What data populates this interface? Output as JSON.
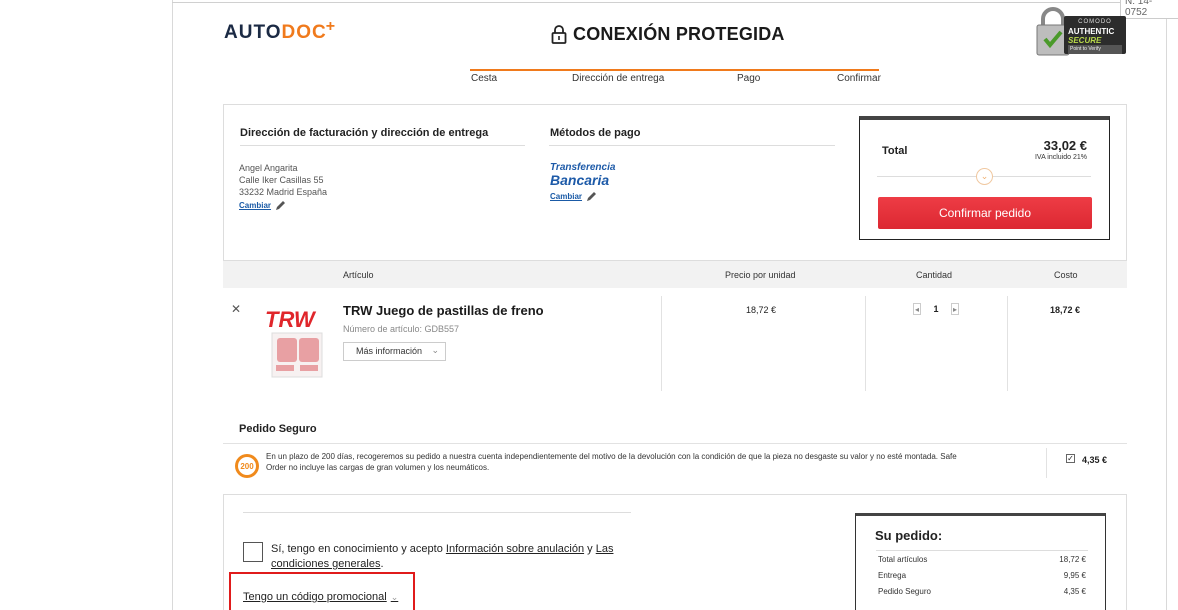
{
  "corner_label": "N: 14-0752",
  "logo": {
    "part1": "AUTO",
    "part2": "DOC",
    "plus": "+"
  },
  "header": {
    "title": "CONEXIÓN PROTEGIDA"
  },
  "badge": {
    "line1": "COMODO",
    "line2": "AUTHENTIC",
    "line3": "SECURE",
    "line4": "Point to Verify"
  },
  "steps": [
    "Cesta",
    "Dirección de entrega",
    "Pago",
    "Confirmar"
  ],
  "billing": {
    "title": "Dirección de facturación y dirección de entrega",
    "lines": [
      "Angel Angarita",
      "Calle Iker Casillas 55",
      "33232 Madrid España"
    ],
    "change_label": "Cambiar"
  },
  "payment": {
    "title": "Métodos de pago",
    "logo_line1": "Transferencia",
    "logo_line2": "Bancaria",
    "change_label": "Cambiar"
  },
  "total_box": {
    "label": "Total",
    "value": "33,02 €",
    "iva": "IVA incluido 21%",
    "confirm_label": "Confirmar pedido",
    "accent_color": "#e8343d"
  },
  "table": {
    "headers": {
      "article": "Artículo",
      "unit_price": "Precio por unidad",
      "quantity": "Cantidad",
      "cost": "Costo"
    }
  },
  "product": {
    "brand_logo": "TRW",
    "name": "TRW Juego de pastillas de freno",
    "number": "Número de artículo: GDB557",
    "more_info_label": "Más información",
    "unit_price": "18,72 €",
    "quantity": "1",
    "cost": "18,72 €"
  },
  "safe_order": {
    "title": "Pedido Seguro",
    "icon_text": "200",
    "description": "En un plazo de 200 días, recogeremos su pedido a nuestra cuenta independientemente del motivo de la devolución con la condición de que la pieza no desgaste su valor y no esté montada. Safe Order no incluye las cargas de gran volumen y los neumáticos.",
    "checked": true,
    "price": "4,35 €"
  },
  "terms": {
    "prefix": "Sí, tengo en conocimiento y acepto ",
    "link1": "Información sobre anulación",
    "middle": " y ",
    "link2": "Las condiciones generales",
    "suffix": "."
  },
  "promo": {
    "label": "Tengo un código promocional"
  },
  "summary": {
    "title": "Su pedido:",
    "rows": [
      {
        "label": "Total artículos",
        "value": "18,72 €"
      },
      {
        "label": "Entrega",
        "value": "9,95 €"
      },
      {
        "label": "Pedido Seguro",
        "value": "4,35 €"
      }
    ]
  }
}
